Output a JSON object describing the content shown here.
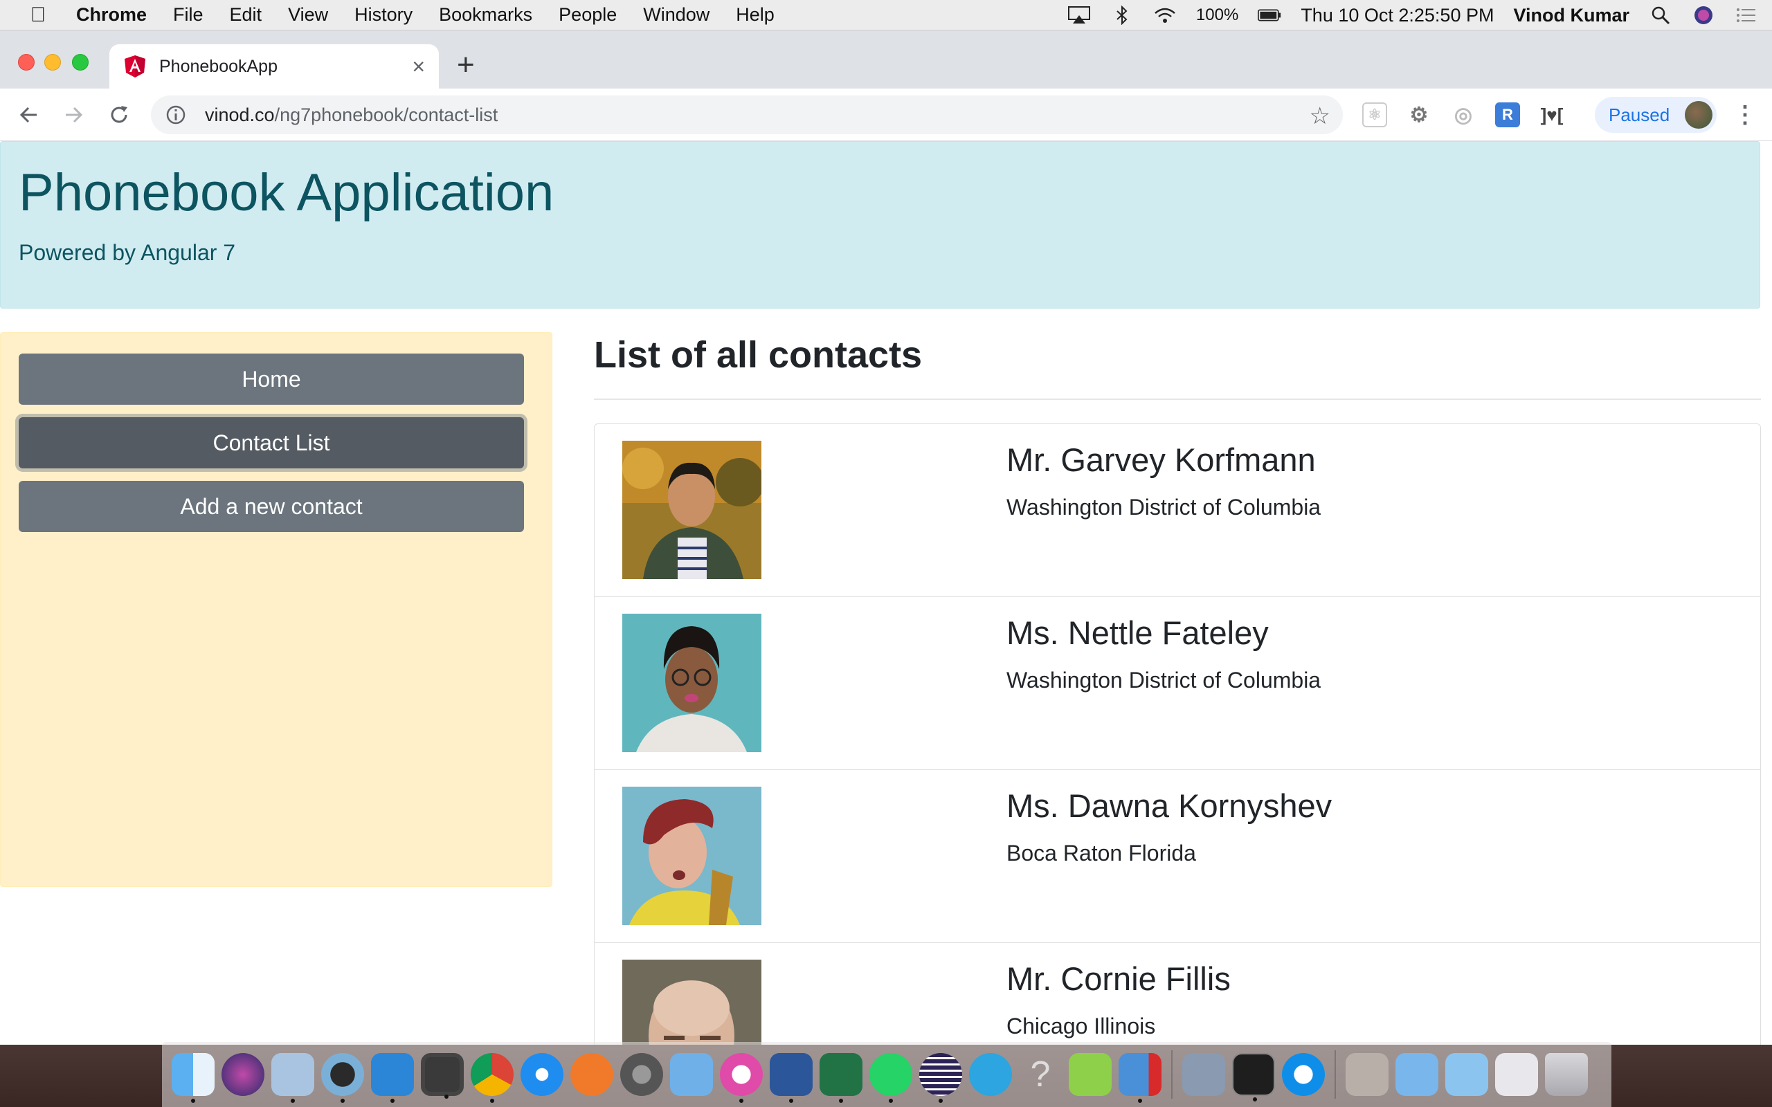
{
  "menubar": {
    "app": "Chrome",
    "items": [
      "File",
      "Edit",
      "View",
      "History",
      "Bookmarks",
      "People",
      "Window",
      "Help"
    ],
    "battery": "100%",
    "datetime": "Thu 10 Oct  2:25:50 PM",
    "user": "Vinod Kumar"
  },
  "browser": {
    "tab_title": "PhonebookApp",
    "url_domain": "vinod.co",
    "url_path": "/ng7phonebook/contact-list",
    "profile_status": "Paused",
    "extension_r_label": "R"
  },
  "page": {
    "title": "Phonebook Application",
    "subtitle": "Powered by Angular 7",
    "nav": {
      "home": "Home",
      "contact_list": "Contact List",
      "add_contact": "Add a new contact"
    },
    "list_heading": "List of all contacts",
    "contacts": [
      {
        "name": "Mr. Garvey Korfmann",
        "city": "Washington District of Columbia"
      },
      {
        "name": "Ms. Nettle Fateley",
        "city": "Washington District of Columbia"
      },
      {
        "name": "Ms. Dawna Kornyshev",
        "city": "Boca Raton Florida"
      },
      {
        "name": "Mr. Cornie Fillis",
        "city": "Chicago Illinois"
      }
    ]
  },
  "colors": {
    "jumbotron_bg": "#d1ecf1",
    "jumbotron_text": "#0c5460",
    "sidebar_bg": "#fff0c9",
    "button_bg": "#6c757d",
    "button_active_bg": "#545b62"
  },
  "dock_icons": [
    "finder-icon",
    "siri-icon",
    "preview-icon",
    "quicktime-icon",
    "vscode-icon",
    "sublime-icon",
    "chrome-icon",
    "safari-icon",
    "sketch-icon",
    "system-preferences-icon",
    "keynote-icon",
    "itunes-icon",
    "word-icon",
    "excel-icon",
    "whatsapp-icon",
    "eclipse-icon",
    "telegram-icon",
    "help-icon",
    "camtasia-icon",
    "parallels-icon",
    "photos-icon",
    "terminal-icon",
    "teamviewer-icon",
    "folder-icon",
    "applications-folder-icon",
    "documents-folder-icon",
    "downloads-folder-icon",
    "trash-icon"
  ]
}
